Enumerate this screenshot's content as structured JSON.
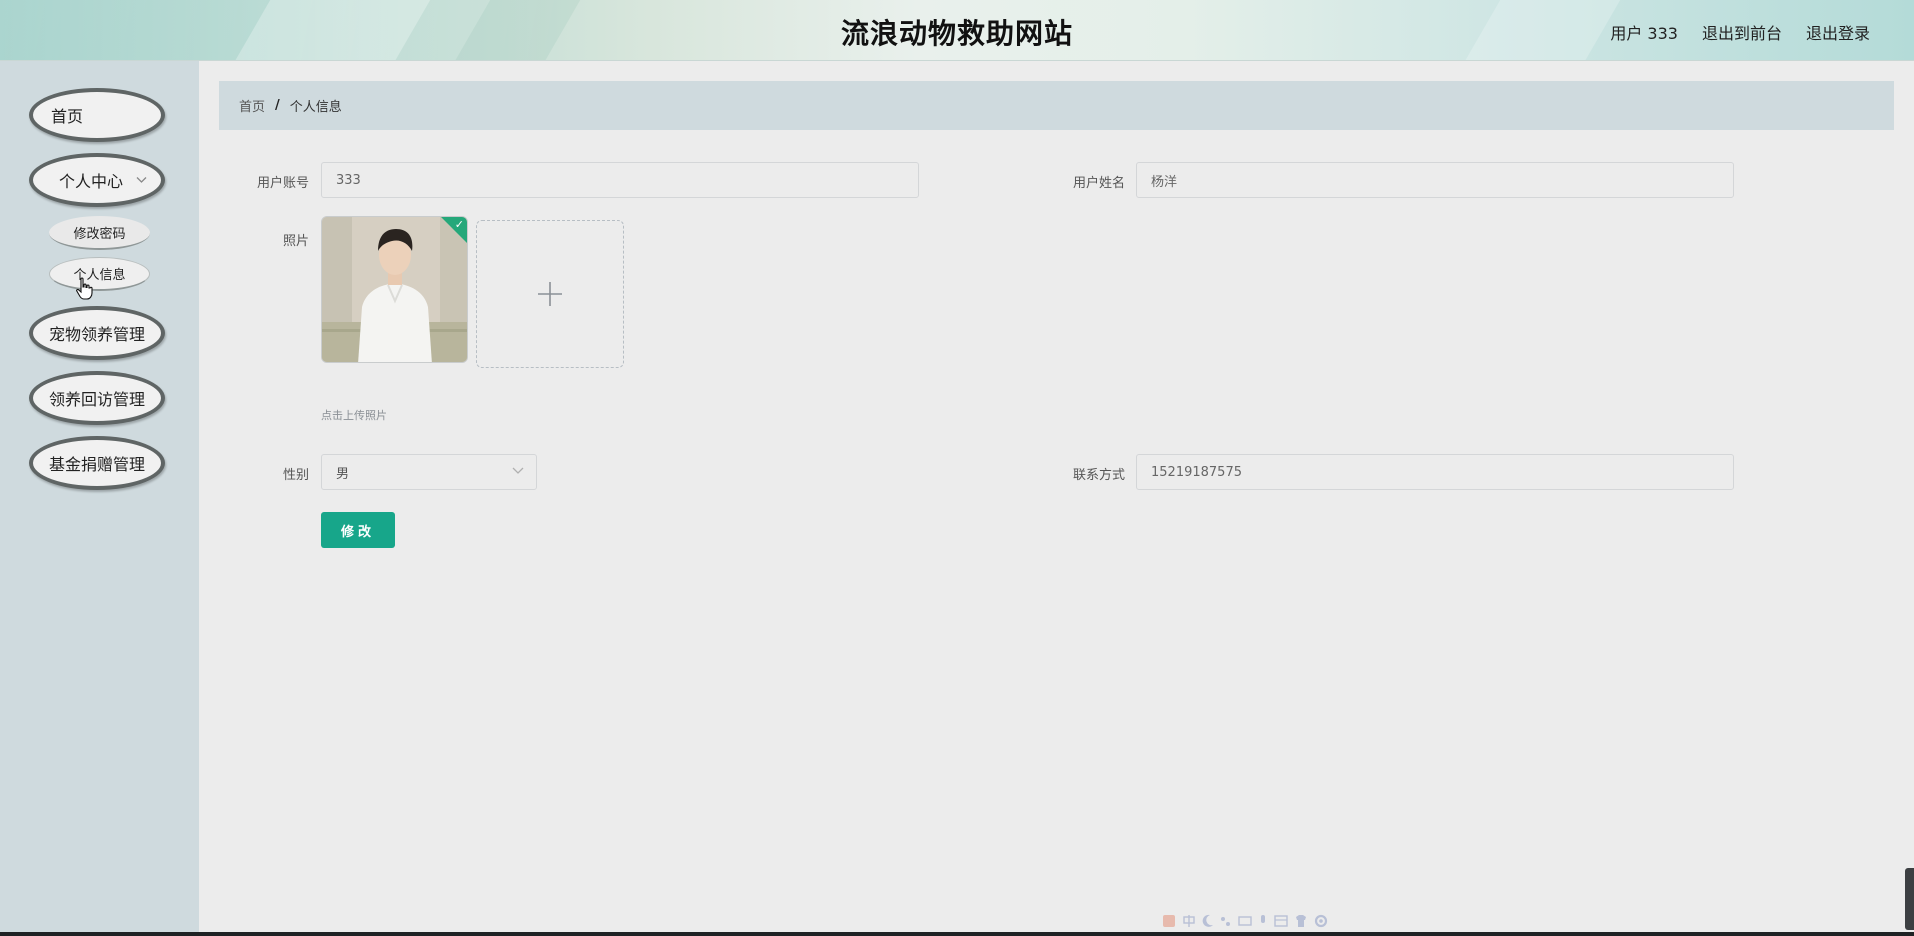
{
  "header": {
    "site_title": "流浪动物救助网站",
    "user_label": "用户 333",
    "front_label": "退出到前台",
    "logout_label": "退出登录"
  },
  "sidebar": {
    "items": [
      {
        "label": "首页"
      },
      {
        "label": "个人中心",
        "expanded": true,
        "sub": [
          {
            "label": "修改密码"
          },
          {
            "label": "个人信息",
            "active": true
          }
        ]
      },
      {
        "label": "宠物领养管理"
      },
      {
        "label": "领养回访管理"
      },
      {
        "label": "基金捐赠管理"
      }
    ]
  },
  "breadcrumb": {
    "home": "首页",
    "separator": "/",
    "current": "个人信息"
  },
  "form": {
    "account_label": "用户账号",
    "account_value": "333",
    "name_label": "用户姓名",
    "name_value": "杨洋",
    "photo_label": "照片",
    "upload_hint": "点击上传照片",
    "gender_label": "性别",
    "gender_value": "男",
    "phone_label": "联系方式",
    "phone_value": "15219187575",
    "submit_label": "修改"
  },
  "colors": {
    "accent": "#17a68a",
    "sidebar_bg": "#cfdade",
    "page_bg": "#ececec",
    "upload_success": "#25a87a"
  },
  "icons": {
    "dropdown": "chevron-down-icon",
    "upload": "plus-icon",
    "success": "check-icon",
    "cursor": "hand-pointer-icon"
  }
}
